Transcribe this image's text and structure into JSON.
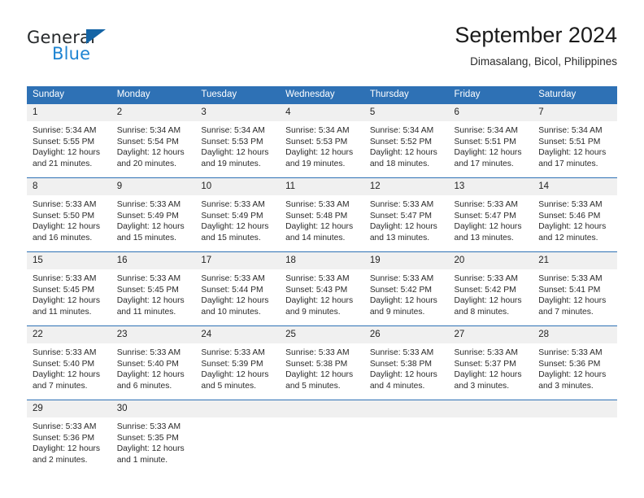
{
  "logo": {
    "word_one": "General",
    "word_two": "Blue",
    "triangle_color": "#1464a5",
    "blue_color": "#1e84d2"
  },
  "header": {
    "title": "September 2024",
    "subtitle": "Dimasalang, Bicol, Philippines"
  },
  "theme": {
    "accent": "#2e71b5",
    "daynum_background": "#f0f0f0",
    "header_text": "#ffffff"
  },
  "labels": {
    "sunrise_prefix": "Sunrise:",
    "sunset_prefix": "Sunset:",
    "daylight_prefix": "Daylight:"
  },
  "weekday_headers": [
    "Sunday",
    "Monday",
    "Tuesday",
    "Wednesday",
    "Thursday",
    "Friday",
    "Saturday"
  ],
  "weeks": [
    [
      {
        "day": "1",
        "sunrise": "Sunrise: 5:34 AM",
        "sunset": "Sunset: 5:55 PM",
        "daylight_1": "Daylight: 12 hours",
        "daylight_2": "and 21 minutes."
      },
      {
        "day": "2",
        "sunrise": "Sunrise: 5:34 AM",
        "sunset": "Sunset: 5:54 PM",
        "daylight_1": "Daylight: 12 hours",
        "daylight_2": "and 20 minutes."
      },
      {
        "day": "3",
        "sunrise": "Sunrise: 5:34 AM",
        "sunset": "Sunset: 5:53 PM",
        "daylight_1": "Daylight: 12 hours",
        "daylight_2": "and 19 minutes."
      },
      {
        "day": "4",
        "sunrise": "Sunrise: 5:34 AM",
        "sunset": "Sunset: 5:53 PM",
        "daylight_1": "Daylight: 12 hours",
        "daylight_2": "and 19 minutes."
      },
      {
        "day": "5",
        "sunrise": "Sunrise: 5:34 AM",
        "sunset": "Sunset: 5:52 PM",
        "daylight_1": "Daylight: 12 hours",
        "daylight_2": "and 18 minutes."
      },
      {
        "day": "6",
        "sunrise": "Sunrise: 5:34 AM",
        "sunset": "Sunset: 5:51 PM",
        "daylight_1": "Daylight: 12 hours",
        "daylight_2": "and 17 minutes."
      },
      {
        "day": "7",
        "sunrise": "Sunrise: 5:34 AM",
        "sunset": "Sunset: 5:51 PM",
        "daylight_1": "Daylight: 12 hours",
        "daylight_2": "and 17 minutes."
      }
    ],
    [
      {
        "day": "8",
        "sunrise": "Sunrise: 5:33 AM",
        "sunset": "Sunset: 5:50 PM",
        "daylight_1": "Daylight: 12 hours",
        "daylight_2": "and 16 minutes."
      },
      {
        "day": "9",
        "sunrise": "Sunrise: 5:33 AM",
        "sunset": "Sunset: 5:49 PM",
        "daylight_1": "Daylight: 12 hours",
        "daylight_2": "and 15 minutes."
      },
      {
        "day": "10",
        "sunrise": "Sunrise: 5:33 AM",
        "sunset": "Sunset: 5:49 PM",
        "daylight_1": "Daylight: 12 hours",
        "daylight_2": "and 15 minutes."
      },
      {
        "day": "11",
        "sunrise": "Sunrise: 5:33 AM",
        "sunset": "Sunset: 5:48 PM",
        "daylight_1": "Daylight: 12 hours",
        "daylight_2": "and 14 minutes."
      },
      {
        "day": "12",
        "sunrise": "Sunrise: 5:33 AM",
        "sunset": "Sunset: 5:47 PM",
        "daylight_1": "Daylight: 12 hours",
        "daylight_2": "and 13 minutes."
      },
      {
        "day": "13",
        "sunrise": "Sunrise: 5:33 AM",
        "sunset": "Sunset: 5:47 PM",
        "daylight_1": "Daylight: 12 hours",
        "daylight_2": "and 13 minutes."
      },
      {
        "day": "14",
        "sunrise": "Sunrise: 5:33 AM",
        "sunset": "Sunset: 5:46 PM",
        "daylight_1": "Daylight: 12 hours",
        "daylight_2": "and 12 minutes."
      }
    ],
    [
      {
        "day": "15",
        "sunrise": "Sunrise: 5:33 AM",
        "sunset": "Sunset: 5:45 PM",
        "daylight_1": "Daylight: 12 hours",
        "daylight_2": "and 11 minutes."
      },
      {
        "day": "16",
        "sunrise": "Sunrise: 5:33 AM",
        "sunset": "Sunset: 5:45 PM",
        "daylight_1": "Daylight: 12 hours",
        "daylight_2": "and 11 minutes."
      },
      {
        "day": "17",
        "sunrise": "Sunrise: 5:33 AM",
        "sunset": "Sunset: 5:44 PM",
        "daylight_1": "Daylight: 12 hours",
        "daylight_2": "and 10 minutes."
      },
      {
        "day": "18",
        "sunrise": "Sunrise: 5:33 AM",
        "sunset": "Sunset: 5:43 PM",
        "daylight_1": "Daylight: 12 hours",
        "daylight_2": "and 9 minutes."
      },
      {
        "day": "19",
        "sunrise": "Sunrise: 5:33 AM",
        "sunset": "Sunset: 5:42 PM",
        "daylight_1": "Daylight: 12 hours",
        "daylight_2": "and 9 minutes."
      },
      {
        "day": "20",
        "sunrise": "Sunrise: 5:33 AM",
        "sunset": "Sunset: 5:42 PM",
        "daylight_1": "Daylight: 12 hours",
        "daylight_2": "and 8 minutes."
      },
      {
        "day": "21",
        "sunrise": "Sunrise: 5:33 AM",
        "sunset": "Sunset: 5:41 PM",
        "daylight_1": "Daylight: 12 hours",
        "daylight_2": "and 7 minutes."
      }
    ],
    [
      {
        "day": "22",
        "sunrise": "Sunrise: 5:33 AM",
        "sunset": "Sunset: 5:40 PM",
        "daylight_1": "Daylight: 12 hours",
        "daylight_2": "and 7 minutes."
      },
      {
        "day": "23",
        "sunrise": "Sunrise: 5:33 AM",
        "sunset": "Sunset: 5:40 PM",
        "daylight_1": "Daylight: 12 hours",
        "daylight_2": "and 6 minutes."
      },
      {
        "day": "24",
        "sunrise": "Sunrise: 5:33 AM",
        "sunset": "Sunset: 5:39 PM",
        "daylight_1": "Daylight: 12 hours",
        "daylight_2": "and 5 minutes."
      },
      {
        "day": "25",
        "sunrise": "Sunrise: 5:33 AM",
        "sunset": "Sunset: 5:38 PM",
        "daylight_1": "Daylight: 12 hours",
        "daylight_2": "and 5 minutes."
      },
      {
        "day": "26",
        "sunrise": "Sunrise: 5:33 AM",
        "sunset": "Sunset: 5:38 PM",
        "daylight_1": "Daylight: 12 hours",
        "daylight_2": "and 4 minutes."
      },
      {
        "day": "27",
        "sunrise": "Sunrise: 5:33 AM",
        "sunset": "Sunset: 5:37 PM",
        "daylight_1": "Daylight: 12 hours",
        "daylight_2": "and 3 minutes."
      },
      {
        "day": "28",
        "sunrise": "Sunrise: 5:33 AM",
        "sunset": "Sunset: 5:36 PM",
        "daylight_1": "Daylight: 12 hours",
        "daylight_2": "and 3 minutes."
      }
    ],
    [
      {
        "day": "29",
        "sunrise": "Sunrise: 5:33 AM",
        "sunset": "Sunset: 5:36 PM",
        "daylight_1": "Daylight: 12 hours",
        "daylight_2": "and 2 minutes."
      },
      {
        "day": "30",
        "sunrise": "Sunrise: 5:33 AM",
        "sunset": "Sunset: 5:35 PM",
        "daylight_1": "Daylight: 12 hours",
        "daylight_2": "and 1 minute."
      },
      {
        "day": "",
        "sunrise": "",
        "sunset": "",
        "daylight_1": "",
        "daylight_2": "",
        "blank": true
      },
      {
        "day": "",
        "sunrise": "",
        "sunset": "",
        "daylight_1": "",
        "daylight_2": "",
        "blank": true
      },
      {
        "day": "",
        "sunrise": "",
        "sunset": "",
        "daylight_1": "",
        "daylight_2": "",
        "blank": true
      },
      {
        "day": "",
        "sunrise": "",
        "sunset": "",
        "daylight_1": "",
        "daylight_2": "",
        "blank": true
      },
      {
        "day": "",
        "sunrise": "",
        "sunset": "",
        "daylight_1": "",
        "daylight_2": "",
        "blank": true
      }
    ]
  ]
}
